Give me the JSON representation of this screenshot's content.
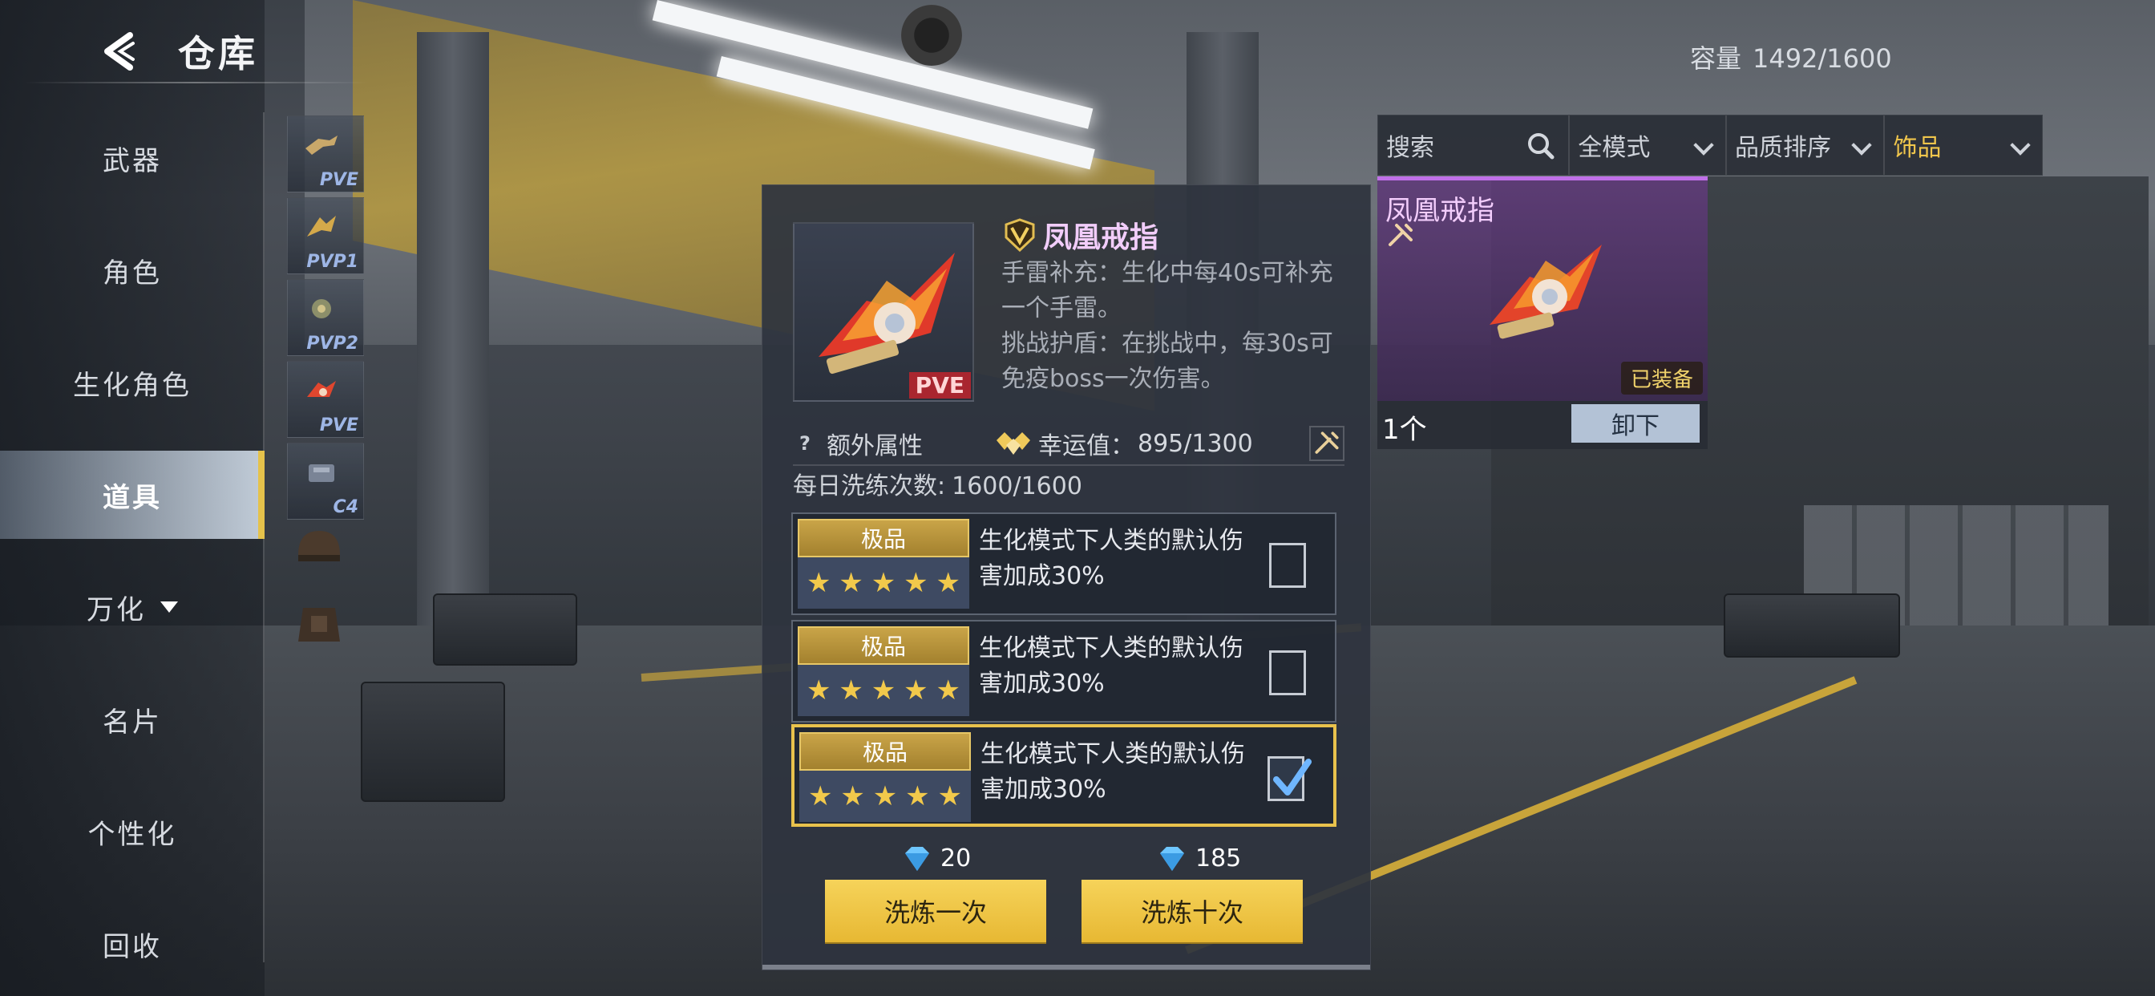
{
  "header": {
    "title": "仓库"
  },
  "capacity": {
    "label": "容量",
    "value": "1492/1600"
  },
  "nav": {
    "items": [
      {
        "label": "武器"
      },
      {
        "label": "角色"
      },
      {
        "label": "生化角色"
      },
      {
        "label": "道具",
        "active": true
      },
      {
        "label": "万化"
      },
      {
        "label": "名片"
      },
      {
        "label": "个性化"
      },
      {
        "label": "回收"
      }
    ]
  },
  "subcategories": [
    "PVE",
    "PVP1",
    "PVP2",
    "PVE",
    "C4"
  ],
  "filters": {
    "search_placeholder": "搜索",
    "mode": "全模式",
    "sort": "品质排序",
    "category": "饰品"
  },
  "equipped": {
    "name": "凤凰戒指",
    "badge": "已装备",
    "count": "1个",
    "unequip_label": "卸下"
  },
  "item": {
    "badge": "PVE",
    "name": "凤凰戒指",
    "desc_line1": "手雷补充：生化中每40s可补充一个手雷。",
    "desc_line2": "挑战护盾：在挑战中，每30s可免疫boss一次伤害。",
    "extra_attr_label": "额外属性",
    "luck_label": "幸运值：",
    "luck_value": "895/1300",
    "daily_label": "每日洗练次数:",
    "daily_value": "1600/1600"
  },
  "options": [
    {
      "grade": "极品",
      "stars": 5,
      "text": "生化模式下人类的默认伤害加成30%",
      "checked": false
    },
    {
      "grade": "极品",
      "stars": 5,
      "text": "生化模式下人类的默认伤害加成30%",
      "checked": false
    },
    {
      "grade": "极品",
      "stars": 5,
      "text": "生化模式下人类的默认伤害加成30%",
      "checked": true
    }
  ],
  "refine": {
    "once_cost": "20",
    "once_label": "洗炼一次",
    "ten_cost": "185",
    "ten_label": "洗炼十次"
  },
  "colors": {
    "accent_gold": "#e9c24c",
    "legendary_purple": "#c070e8",
    "pve_red": "#a9262f"
  }
}
